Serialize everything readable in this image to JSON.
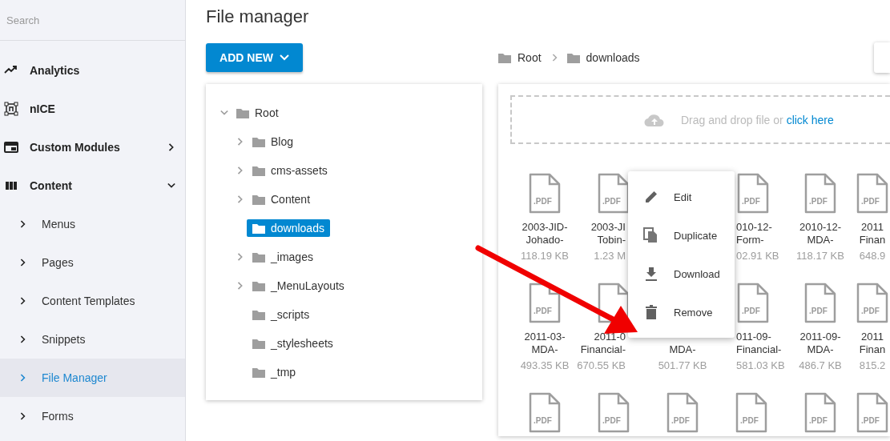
{
  "sidebar": {
    "search": {
      "placeholder": "Search"
    },
    "items": [
      {
        "label": "Analytics",
        "kind": "link"
      },
      {
        "label": "nICE",
        "kind": "link"
      },
      {
        "label": "Custom Modules",
        "kind": "group",
        "expanded": false
      },
      {
        "label": "Content",
        "kind": "group",
        "expanded": true,
        "children": [
          {
            "label": "Menus",
            "selected": false
          },
          {
            "label": "Pages",
            "selected": false
          },
          {
            "label": "Content Templates",
            "selected": false
          },
          {
            "label": "Snippets",
            "selected": false
          },
          {
            "label": "File Manager",
            "selected": true
          },
          {
            "label": "Forms",
            "selected": false
          }
        ]
      }
    ]
  },
  "page_title": "File manager",
  "add_button": "ADD NEW",
  "breadcrumb": [
    "Root",
    "downloads"
  ],
  "tree": {
    "label": "Root",
    "kind": "branch",
    "expanded": true,
    "selected": false,
    "children": [
      {
        "label": "Blog",
        "kind": "branch",
        "expanded": false,
        "selected": false
      },
      {
        "label": "cms-assets",
        "kind": "branch",
        "expanded": false,
        "selected": false
      },
      {
        "label": "Content",
        "kind": "branch",
        "expanded": false,
        "selected": false
      },
      {
        "label": "downloads",
        "kind": "leaf",
        "selected": true
      },
      {
        "label": "_images",
        "kind": "branch",
        "expanded": false,
        "selected": false
      },
      {
        "label": "_MenuLayouts",
        "kind": "branch",
        "expanded": false,
        "selected": false
      },
      {
        "label": "_scripts",
        "kind": "leaf",
        "selected": false
      },
      {
        "label": "_stylesheets",
        "kind": "leaf",
        "selected": false
      },
      {
        "label": "_tmp",
        "kind": "leaf",
        "selected": false
      }
    ]
  },
  "dropzone": {
    "text": "Drag and drop file or",
    "link": "click here"
  },
  "files": [
    {
      "kind": "file",
      "badge": ".PDF",
      "name_lines": [
        "2003-JID-",
        "Johado-"
      ],
      "size": "118.19 KB"
    },
    {
      "kind": "cut_right",
      "badge": ".PDF",
      "name_lines": [
        "2003-JI",
        "Tobin-"
      ],
      "size": "1.23 M"
    },
    {
      "kind": "covered"
    },
    {
      "kind": "cut_left",
      "badge": ".PDF",
      "name_lines": [
        "010-12-",
        "Form-"
      ],
      "size": "02.91 KB"
    },
    {
      "kind": "file",
      "badge": ".PDF",
      "name_lines": [
        "2010-12-",
        "MDA-"
      ],
      "size": "118.17 KB"
    },
    {
      "kind": "file",
      "badge": ".PDF",
      "name_lines": [
        "2011",
        "Finan"
      ],
      "size": "648.9"
    },
    {
      "kind": "file",
      "badge": ".PDF",
      "name_lines": [
        "2011-03-",
        "MDA-"
      ],
      "size": "493.35 KB"
    },
    {
      "kind": "cut_right",
      "name_lines": [
        "2011-0",
        "Financial-"
      ],
      "size": "670.55 KB"
    },
    {
      "kind": "covered_top",
      "name_lines": [
        "MDA-"
      ],
      "size": "501.77 KB"
    },
    {
      "kind": "cut_left",
      "badge": ".PDF",
      "name_lines": [
        "011-09-",
        "Financial-"
      ],
      "size": "581.03 KB"
    },
    {
      "kind": "file",
      "badge": ".PDF",
      "name_lines": [
        "2011-09-",
        "MDA-"
      ],
      "size": "486.7 KB"
    },
    {
      "kind": "file",
      "badge": ".PDF",
      "name_lines": [
        "2011",
        "Finan"
      ],
      "size": "815.2"
    },
    {
      "kind": "file",
      "badge": ".PDF"
    },
    {
      "kind": "file",
      "badge": ".PDF"
    },
    {
      "kind": "file",
      "badge": ".PDF"
    },
    {
      "kind": "file",
      "badge": ".PDF"
    },
    {
      "kind": "file",
      "badge": ".PDF"
    },
    {
      "kind": "file",
      "badge": ".PDF"
    }
  ],
  "context_menu": [
    "Edit",
    "Duplicate",
    "Download",
    "Remove"
  ]
}
